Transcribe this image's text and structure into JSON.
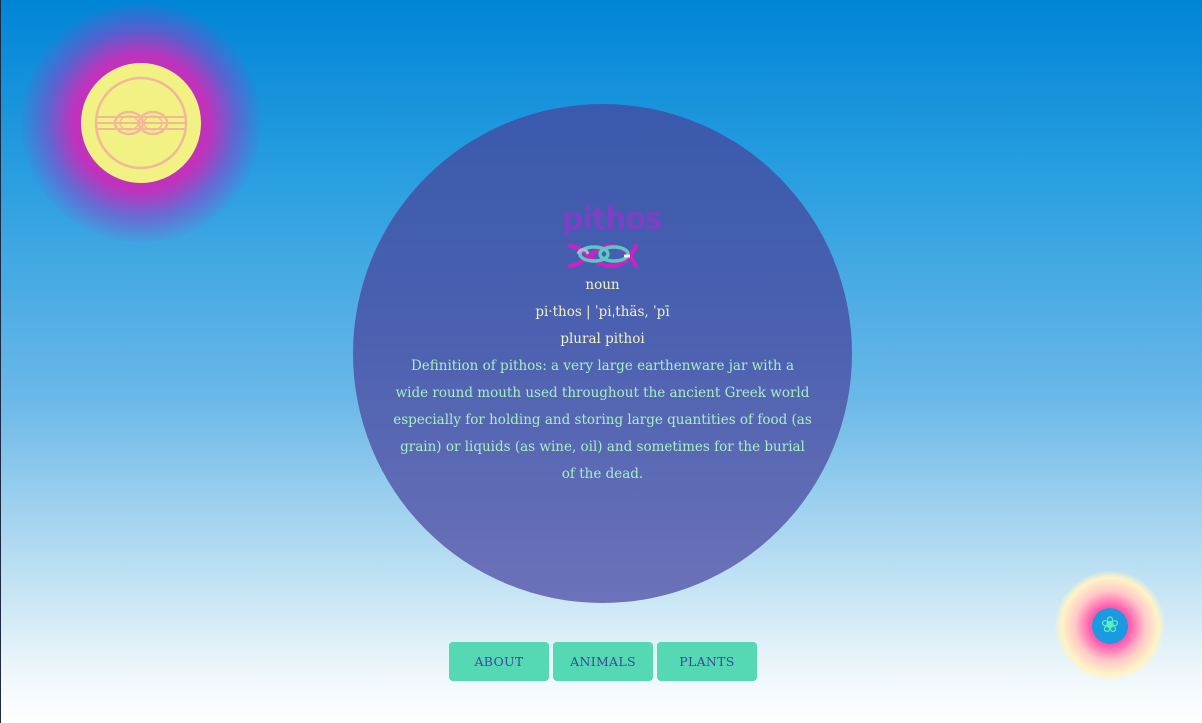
{
  "logo": {
    "word": "pithos",
    "icon": "knot-icon"
  },
  "entry": {
    "part_of_speech": "noun",
    "pronunciation": "pi·thos | ˈpiˌthäs, ˈpī",
    "plural": "plural pithoi",
    "definition": "Definition of pithos: a very large earthenware jar with a wide round mouth used throughout the ancient Greek world especially for holding and storing large quantities of food (as grain) or liquids (as wine, oil) and sometimes for the burial of the dead."
  },
  "nav": {
    "items": [
      {
        "label": "ABOUT"
      },
      {
        "label": "ANIMALS"
      },
      {
        "label": "PLANTS"
      }
    ]
  },
  "badges": {
    "top_left": {
      "icon": "knot-seal-icon",
      "disc_color": "#f1f184",
      "glow_color": "#c628b4"
    },
    "bottom_right": {
      "icon": "flower-icon",
      "glyph": "❀",
      "disc_color": "#1a9ae0",
      "glow_color": "#ff3aa0"
    }
  },
  "colors": {
    "circle": "#4b60b0",
    "button": "#55d8b4",
    "button_text": "#3a4a9a",
    "definition_text": "#a7efc4",
    "body_text": "#f2f2c0"
  }
}
